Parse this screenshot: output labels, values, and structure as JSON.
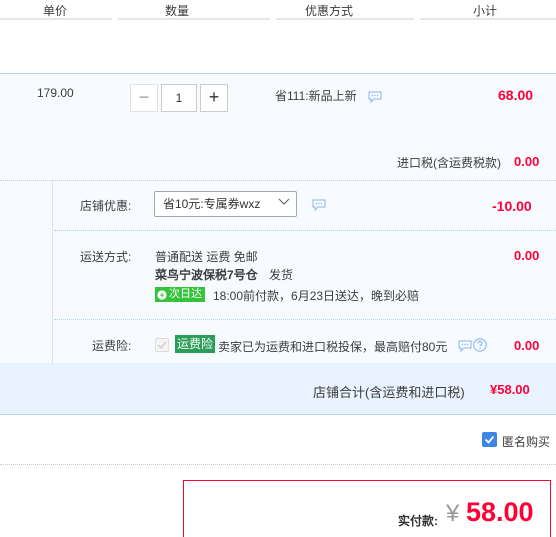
{
  "header": {
    "col_price": "单价",
    "col_qty": "数量",
    "col_discount": "优惠方式",
    "col_subtotal": "小计"
  },
  "item": {
    "unit_price": "179.00",
    "quantity": "1",
    "minus_glyph": "−",
    "plus_glyph": "+",
    "promotion": "省111:新品上新",
    "subtotal": "68.00",
    "import_tax_label": "进口税(含运费税款)",
    "import_tax_value": "0.00"
  },
  "shop": {
    "discount_label": "店铺优惠:",
    "discount_selected": "省10元:专属券wxz",
    "discount_value": "-10.00",
    "shipping_label": "运送方式:",
    "shipping_method": "普通配送 运费 免邮",
    "warehouse": "菜鸟宁波保税7号仓",
    "warehouse_status": "发货",
    "next_day_badge": "次日达",
    "delivery_promise": "18:00前付款，6月23日送达，晚到必赔",
    "shipping_value": "0.00",
    "insurance_label": "运费险:",
    "insurance_tag": "运费险",
    "insurance_desc": "卖家已为运费和进口税投保，最高赔付80元",
    "insurance_value": "0.00",
    "total_label": "店铺合计(含运费和进口税)",
    "total_value": "¥58.00"
  },
  "anonymous": {
    "label": "匿名购买",
    "checked": true
  },
  "payment": {
    "label": "实付款:",
    "currency": "¥",
    "amount": "58.00"
  },
  "colors": {
    "accent_red": "#ff0036",
    "band_blue": "#f7fbff",
    "total_band": "#e9f2ff",
    "checkbox_blue": "#3e86e5",
    "next_day_green": "#36c33c",
    "insurance_green": "#2a9d58"
  },
  "icons": [
    "chat-bubble-icon",
    "help-circle-icon",
    "chevron-down-icon",
    "lightning-icon",
    "checkmark-icon"
  ]
}
